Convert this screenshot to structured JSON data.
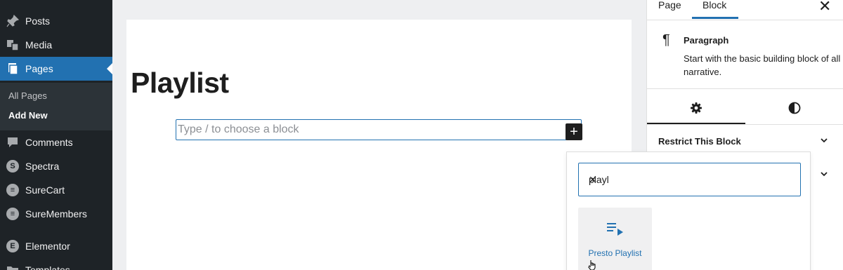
{
  "sidebar": {
    "items": [
      {
        "label": "Posts",
        "icon": "pin-icon"
      },
      {
        "label": "Media",
        "icon": "media-icon"
      },
      {
        "label": "Pages",
        "icon": "pages-icon",
        "active": true
      },
      {
        "label": "Comments",
        "icon": "comment-icon"
      },
      {
        "label": "Spectra",
        "icon": "spectra-icon"
      },
      {
        "label": "SureCart",
        "icon": "surecart-icon"
      },
      {
        "label": "SureMembers",
        "icon": "suremembers-icon"
      },
      {
        "label": "Elementor",
        "icon": "elementor-icon"
      },
      {
        "label": "Templates",
        "icon": "folder-icon"
      }
    ],
    "submenu": [
      {
        "label": "All Pages"
      },
      {
        "label": "Add New",
        "current": true
      }
    ]
  },
  "editor": {
    "page_title": "Playlist",
    "block_placeholder": "Type / to choose a block",
    "inserter_symbol": "+"
  },
  "inspector": {
    "tabs": [
      "Page",
      "Block"
    ],
    "active_tab": "Block",
    "close_symbol": "✕",
    "block_name": "Paragraph",
    "block_description": "Start with the basic building block of all narrative.",
    "panel_title": "Restrict This Block"
  },
  "inserter": {
    "search_value": "playl",
    "clear_symbol": "✕",
    "results": [
      {
        "label": "Presto Playlist",
        "icon": "playlist-icon"
      }
    ]
  },
  "colors": {
    "admin_sidebar": "#1e2327",
    "accent": "#2271b1",
    "canvas": "#ffffff"
  }
}
